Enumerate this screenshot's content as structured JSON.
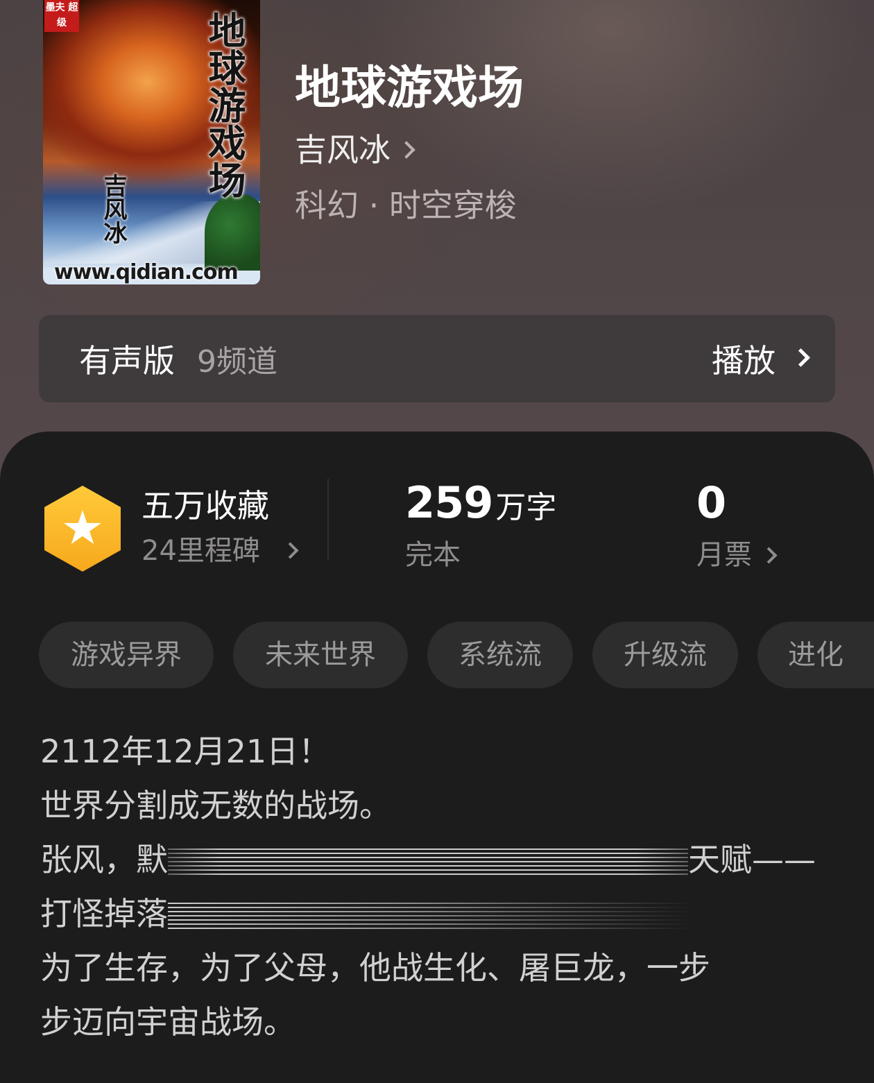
{
  "book": {
    "title": "地球游戏场",
    "author": "吉风冰",
    "genre": "科幻 · 时空穿梭",
    "cover": {
      "badge": "墨夫\n超级",
      "vertical_title": "地球游戏场",
      "vertical_author": "吉风冰",
      "url": "www.qidian.com"
    }
  },
  "audio": {
    "label": "有声版",
    "channel": "9频道",
    "play_label": "播放"
  },
  "stats": {
    "favorites": "五万收藏",
    "milestones": "24里程碑",
    "word_count": "259",
    "word_unit": "万字",
    "status": "完本",
    "monthly_tickets": "0",
    "monthly_tickets_label": "月票"
  },
  "tags": [
    "游戏异界",
    "未来世界",
    "系统流",
    "升级流",
    "进化"
  ],
  "synopsis": {
    "line1": "2112年12月21日！",
    "line2": "世界分割成无数的战场。",
    "line3_start": "张风，默",
    "line3_end": "天赋——",
    "line4_start": "打怪掉落",
    "line5": "为了生存，为了父母，他战生化、屠巨龙，一步",
    "line6": "步迈向宇宙战场。"
  },
  "icons": {
    "collection": "star-hexagon-icon",
    "chevron": "chevron-right-icon"
  },
  "colors": {
    "accent_gold": "#f7a81c",
    "background": "#1c1c1d"
  }
}
